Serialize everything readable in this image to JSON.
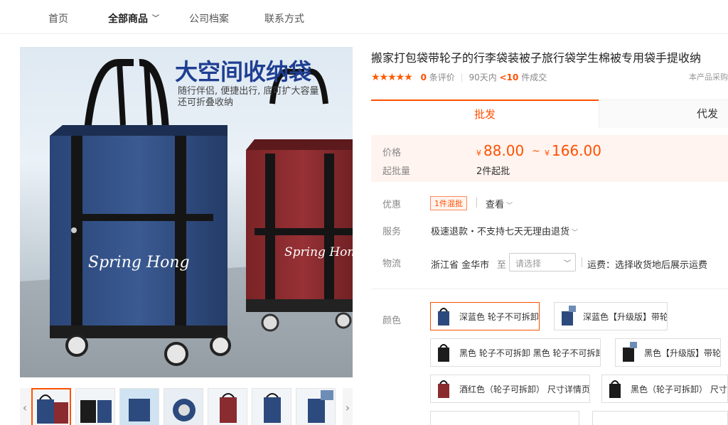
{
  "nav": {
    "items": [
      "首页",
      "全部商品",
      "公司档案",
      "联系方式"
    ]
  },
  "product": {
    "title": "搬家打包袋带轮子的行李袋装被子旅行袋学生棉被专用袋手提收纳",
    "image_headline": "大空间收纳袋",
    "image_subtext_1": "随行伴侣, 便捷出行, 底可扩大容量",
    "image_subtext_2": "还可折叠收纳",
    "brand_print": "Spring Hong"
  },
  "rating": {
    "stars": "★★★★★",
    "count": "0",
    "count_suffix": "条评价",
    "days": "90天内",
    "sold": "<10",
    "sold_suffix": "件成交",
    "note": "本产品采购"
  },
  "tabs": {
    "wholesale": "批发",
    "dropship": "代发"
  },
  "price": {
    "label": "价格",
    "currency": "¥",
    "low": "88.00",
    "tilde": "~",
    "high": "166.00",
    "moq_label": "起批量",
    "moq_value": "2件起批"
  },
  "promo": {
    "label": "优惠",
    "badge": "1件混批",
    "view": "查看"
  },
  "service": {
    "label": "服务",
    "value": "极速退款・不支持七天无理由退货"
  },
  "logistics": {
    "label": "物流",
    "origin": "浙江省 金华市",
    "to": "至",
    "select_placeholder": "请选择",
    "freight": "运费：选择收货地后展示运费"
  },
  "color": {
    "label": "颜色",
    "options": [
      "深蓝色 轮子不可拆卸",
      "深蓝色【升级版】带轮",
      "黑色 轮子不可拆卸 黑色 轮子不可拆卸",
      "黑色【升级版】带轮",
      "酒红色（轮子可拆卸） 尺寸详情页",
      "黑色（轮子可拆卸） 尺寸详"
    ]
  },
  "colors": {
    "accent": "#ff5000",
    "navy": "#2d4a7e",
    "wine": "#8a2b2f"
  }
}
